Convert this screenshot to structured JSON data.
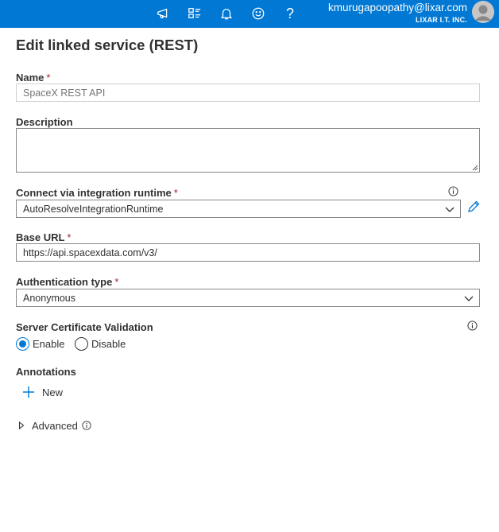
{
  "header": {
    "user_email": "kmurugapoopathy@lixar.com",
    "org_name": "LIXAR I.T. INC.",
    "icons": [
      "megaphone-icon",
      "portal-settings-icon",
      "notifications-bell-icon",
      "feedback-smiley-icon",
      "help-question-icon"
    ],
    "help_glyph": "?",
    "accent_color": "#0078d4"
  },
  "panel": {
    "title": "Edit linked service (REST)"
  },
  "form": {
    "name": {
      "label": "Name",
      "required_mark": "*",
      "placeholder": "SpaceX REST API"
    },
    "description": {
      "label": "Description",
      "value": ""
    },
    "integration_runtime": {
      "label": "Connect via integration runtime",
      "required_mark": "*",
      "selected": "AutoResolveIntegrationRuntime"
    },
    "base_url": {
      "label": "Base URL",
      "required_mark": "*",
      "value": "https://api.spacexdata.com/v3/"
    },
    "authentication_type": {
      "label": "Authentication type",
      "required_mark": "*",
      "selected": "Anonymous"
    },
    "server_certificate_validation": {
      "label": "Server Certificate Validation",
      "options": [
        {
          "label": "Enable",
          "checked": true
        },
        {
          "label": "Disable",
          "checked": false
        }
      ]
    },
    "annotations": {
      "label": "Annotations",
      "new_label": "New"
    },
    "advanced": {
      "label": "Advanced",
      "expanded": false
    }
  }
}
